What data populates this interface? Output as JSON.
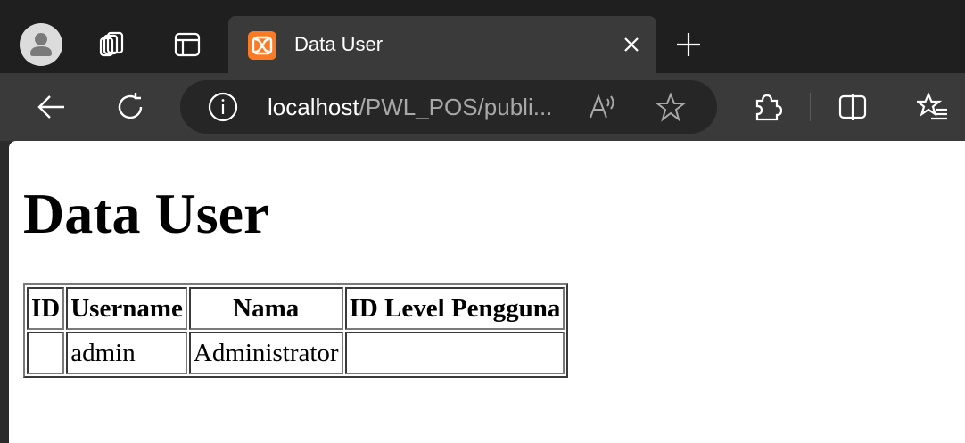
{
  "browser": {
    "tab": {
      "title": "Data User",
      "favicon": "xampp-icon"
    },
    "address_bar": {
      "host": "localhost",
      "path": "/PWL_POS/publi..."
    },
    "icons": {
      "profile": "profile-avatar-icon",
      "workspaces": "workspaces-icon",
      "tab_actions": "tab-actions-icon",
      "close_tab": "close-icon",
      "new_tab": "plus-icon",
      "back": "back-arrow-icon",
      "refresh": "refresh-icon",
      "site_info": "info-icon",
      "read_aloud": "read-aloud-icon",
      "favorite": "star-icon",
      "extensions": "puzzle-icon",
      "split_screen": "split-screen-icon",
      "favorites": "favorites-list-icon"
    },
    "colors": {
      "tab_strip": "#1f1f1f",
      "toolbar": "#3a3a3a",
      "favicon_bg": "#fb7a24"
    }
  },
  "page": {
    "heading": "Data User",
    "table": {
      "headers": [
        "ID",
        "Username",
        "Nama",
        "ID Level Pengguna"
      ],
      "rows": [
        [
          "",
          "admin",
          "Administrator",
          ""
        ]
      ]
    }
  }
}
